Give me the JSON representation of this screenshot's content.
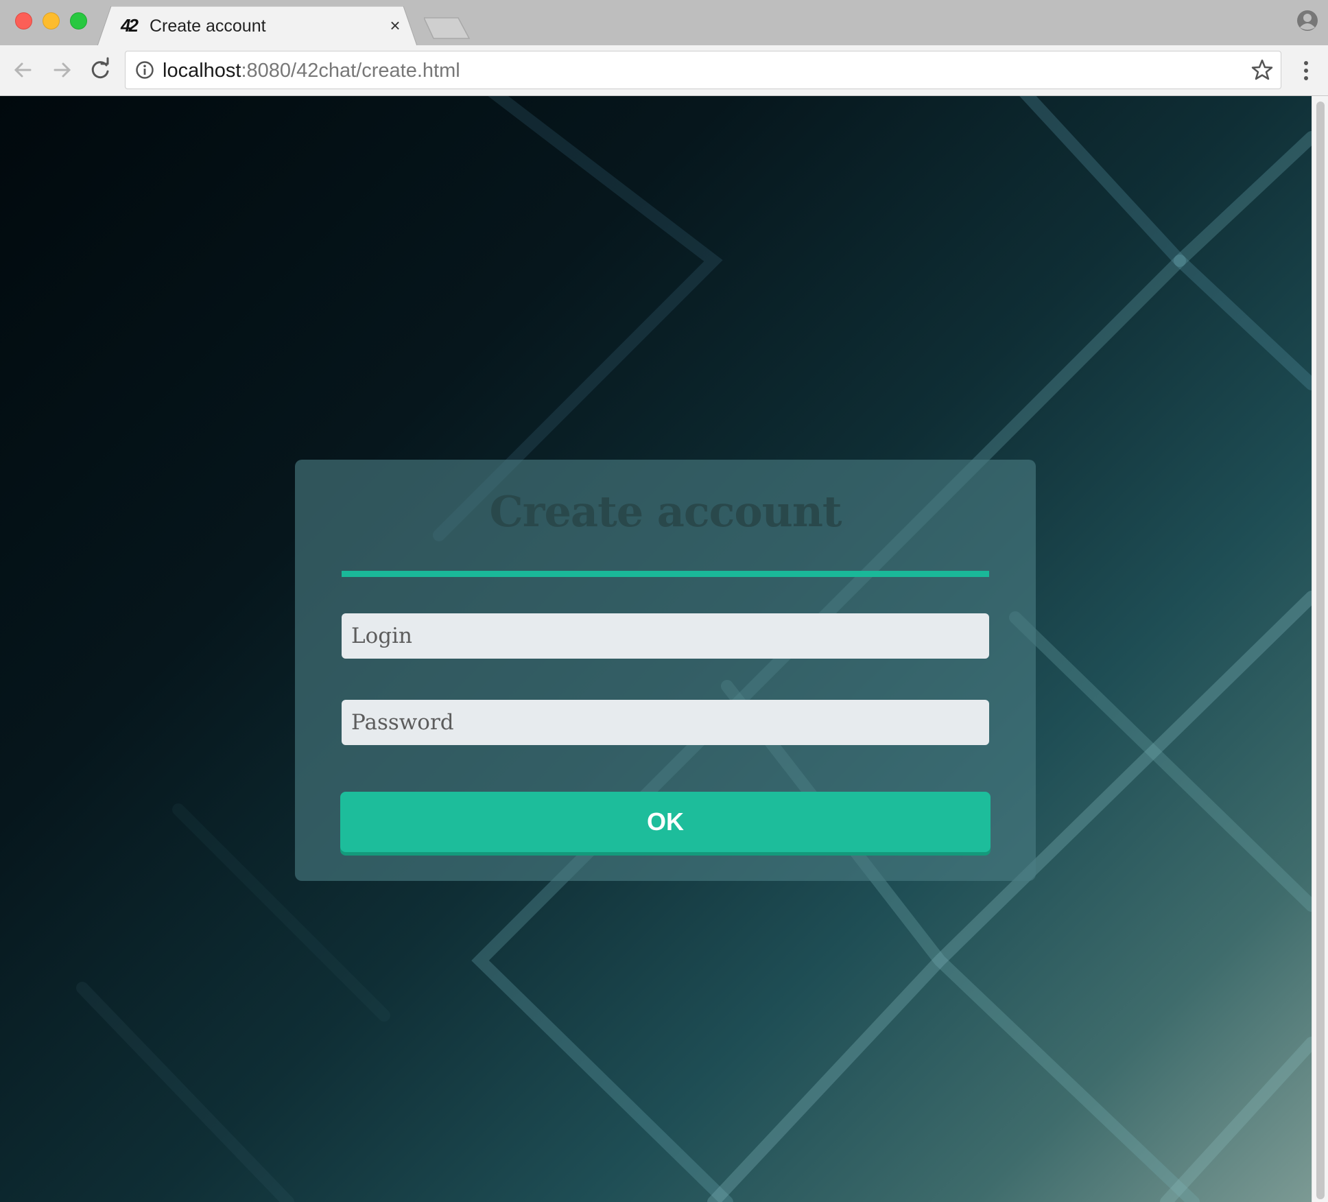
{
  "browser": {
    "tab": {
      "favicon_text": "42",
      "title": "Create account",
      "close_glyph": "×"
    },
    "address_bar": {
      "host": "localhost",
      "path": ":8080/42chat/create.html"
    },
    "icons": {
      "back": "back-arrow-icon",
      "forward": "forward-arrow-icon",
      "reload": "reload-icon",
      "info": "info-icon",
      "bookmark": "star-icon",
      "menu": "kebab-menu-icon",
      "profile": "profile-icon"
    }
  },
  "form": {
    "title": "Create account",
    "login_placeholder": "Login",
    "login_value": "",
    "password_placeholder": "Password",
    "password_value": "",
    "submit_label": "OK"
  },
  "colors": {
    "accent": "#1dbd9b",
    "card_background": "#4b7d82",
    "title_text": "#29484b",
    "field_background": "#e7ebee"
  }
}
